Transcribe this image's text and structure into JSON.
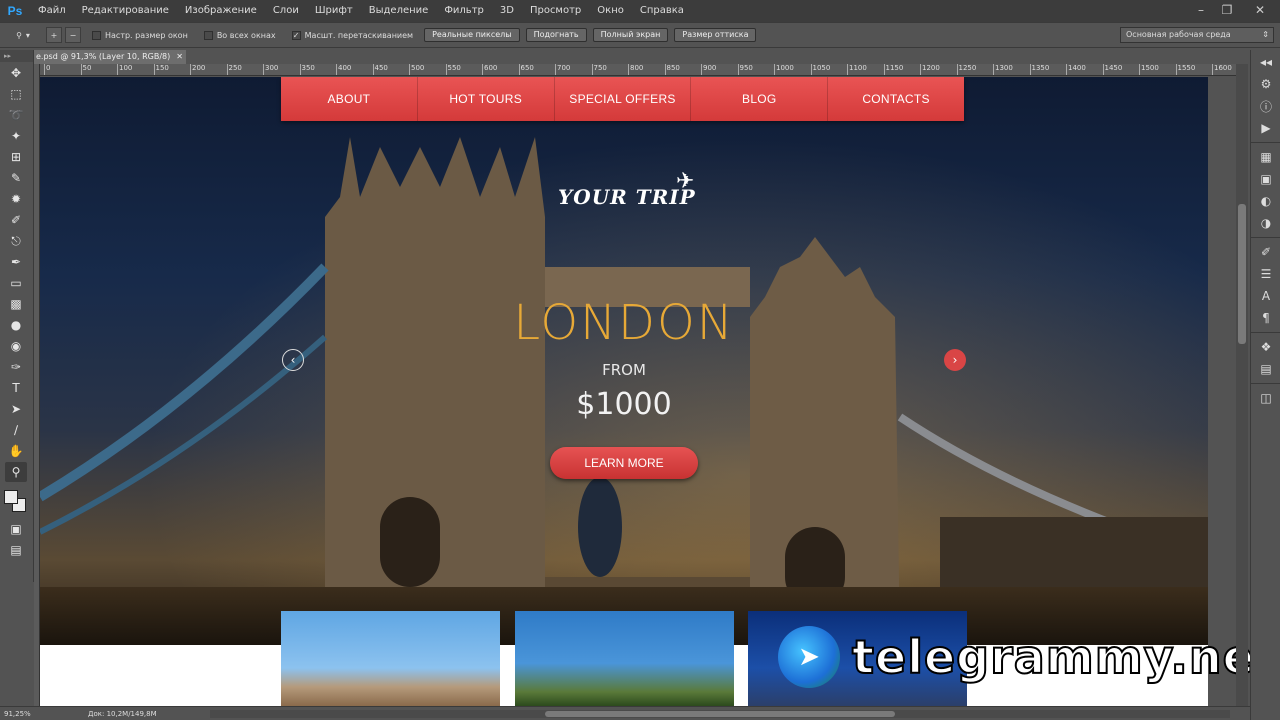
{
  "app": {
    "logo": "Ps",
    "menu": [
      "Файл",
      "Редактирование",
      "Изображение",
      "Слои",
      "Шрифт",
      "Выделение",
      "Фильтр",
      "3D",
      "Просмотр",
      "Окно",
      "Справка"
    ]
  },
  "options": {
    "checkbox_fit": "Настр. размер окон",
    "checkbox_all": "Во всех окнах",
    "checkbox_scrubby": "Масшт. перетаскиванием",
    "btn_actual": "Реальные пикселы",
    "btn_fit": "Подогнать",
    "btn_fill": "Полный экран",
    "btn_print": "Размер оттиска",
    "workspace": "Основная рабочая среда"
  },
  "document": {
    "tab_title": "e.psd @ 91,3% (Layer 10, RGB/8)",
    "ruler_ticks": [
      "0",
      "50",
      "100",
      "150",
      "200",
      "250",
      "300",
      "350",
      "400",
      "450",
      "500",
      "550",
      "600",
      "650",
      "700",
      "750",
      "800",
      "850",
      "900",
      "950",
      "1000",
      "1050",
      "1100",
      "1150",
      "1200",
      "1250",
      "1300",
      "1350",
      "1400",
      "1450",
      "1500",
      "1550",
      "1600"
    ]
  },
  "site": {
    "nav": [
      "ABOUT",
      "HOT TOURS",
      "SPECIAL OFFERS",
      "BLOG",
      "CONTACTS"
    ],
    "logo": "YOUR TRIP",
    "city": "LONDON",
    "from": "FROM",
    "price": "$1000",
    "cta": "LEARN MORE"
  },
  "watermark": "telegrammy.net",
  "status": {
    "zoom": "91,25%",
    "doc": "Док: 10,2M/149,8M"
  }
}
